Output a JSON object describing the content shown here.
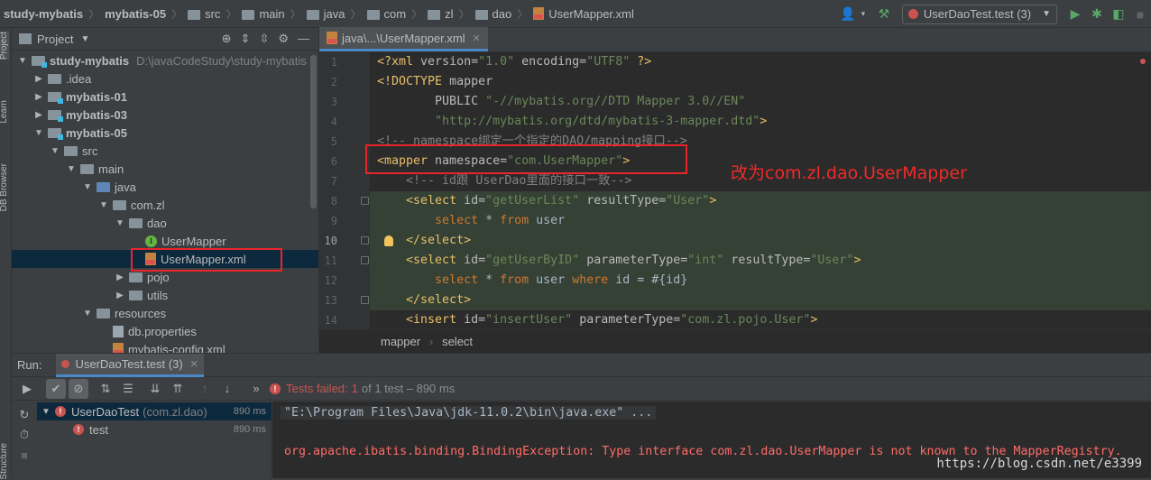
{
  "breadcrumbs": [
    "study-mybatis",
    "mybatis-05",
    "src",
    "main",
    "java",
    "com",
    "zl",
    "dao",
    "UserMapper.xml"
  ],
  "toolbar": {
    "run_config": "UserDaoTest.test (3)"
  },
  "left_strip": {
    "tabs": [
      "Project",
      "Learn",
      "DB Browser",
      "Structure"
    ]
  },
  "project": {
    "title": "Project",
    "tree": [
      {
        "label": "study-mybatis",
        "extra": "D:\\javaCodeStudy\\study-mybatis",
        "depth": 0,
        "arrow": "▼",
        "kind": "module",
        "bold": true
      },
      {
        "label": ".idea",
        "depth": 1,
        "arrow": "▶",
        "kind": "folder"
      },
      {
        "label": "mybatis-01",
        "depth": 1,
        "arrow": "▶",
        "kind": "module",
        "bold": true
      },
      {
        "label": "mybatis-03",
        "depth": 1,
        "arrow": "▶",
        "kind": "module",
        "bold": true
      },
      {
        "label": "mybatis-05",
        "depth": 1,
        "arrow": "▼",
        "kind": "module",
        "bold": true
      },
      {
        "label": "src",
        "depth": 2,
        "arrow": "▼",
        "kind": "folder"
      },
      {
        "label": "main",
        "depth": 3,
        "arrow": "▼",
        "kind": "folder"
      },
      {
        "label": "java",
        "depth": 4,
        "arrow": "▼",
        "kind": "folder-blue"
      },
      {
        "label": "com.zl",
        "depth": 5,
        "arrow": "▼",
        "kind": "folder"
      },
      {
        "label": "dao",
        "depth": 6,
        "arrow": "▼",
        "kind": "folder"
      },
      {
        "label": "UserMapper",
        "depth": 7,
        "arrow": "",
        "kind": "interface"
      },
      {
        "label": "UserMapper.xml",
        "depth": 7,
        "arrow": "",
        "kind": "xml",
        "selected": true
      },
      {
        "label": "pojo",
        "depth": 6,
        "arrow": "▶",
        "kind": "folder"
      },
      {
        "label": "utils",
        "depth": 6,
        "arrow": "▶",
        "kind": "folder"
      },
      {
        "label": "resources",
        "depth": 4,
        "arrow": "▼",
        "kind": "folder-res"
      },
      {
        "label": "db.properties",
        "depth": 5,
        "arrow": "",
        "kind": "props"
      },
      {
        "label": "mybatis-config.xml",
        "depth": 5,
        "arrow": "",
        "kind": "xml"
      }
    ]
  },
  "editor": {
    "tab_label": "java\\...\\UserMapper.xml",
    "line_numbers": [
      "1",
      "2",
      "3",
      "4",
      "5",
      "6",
      "7",
      "8",
      "9",
      "10",
      "11",
      "12",
      "13",
      "14"
    ],
    "lines": [
      [
        [
          "tag",
          "<?xml "
        ],
        [
          "attr",
          "version="
        ],
        [
          "str",
          "\"1.0\""
        ],
        [
          "attr",
          " encoding="
        ],
        [
          "str",
          "\"UTF8\""
        ],
        [
          "tag",
          " ?>"
        ]
      ],
      [
        [
          "tag",
          "<!DOCTYPE "
        ],
        [
          "attr",
          "mapper"
        ]
      ],
      [
        [
          "txt",
          "        "
        ],
        [
          "attr",
          "PUBLIC "
        ],
        [
          "str",
          "\"-//mybatis.org//DTD Mapper 3.0//EN\""
        ]
      ],
      [
        [
          "txt",
          "        "
        ],
        [
          "str",
          "\"http://mybatis.org/dtd/mybatis-3-mapper.dtd\""
        ],
        [
          "tag",
          ">"
        ]
      ],
      [
        [
          "cmt",
          "<!-- namespace绑定一个指定的DAO/mapping接口-->"
        ]
      ],
      [
        [
          "tag",
          "<mapper "
        ],
        [
          "attr",
          "namespace="
        ],
        [
          "str",
          "\"com.UserMapper\""
        ],
        [
          "tag",
          ">"
        ]
      ],
      [
        [
          "cmt",
          "    <!-- id跟 UserDao里面的接口一致-->"
        ]
      ],
      [
        [
          "txt",
          "    "
        ],
        [
          "tag",
          "<select "
        ],
        [
          "attr",
          "id="
        ],
        [
          "str",
          "\"getUserList\""
        ],
        [
          "attr",
          " resultType="
        ],
        [
          "str",
          "\"User\""
        ],
        [
          "tag",
          ">"
        ]
      ],
      [
        [
          "txt",
          "        "
        ],
        [
          "sqlkw",
          "select"
        ],
        [
          "sqlid",
          " * "
        ],
        [
          "sqlkw",
          "from"
        ],
        [
          "sqlid",
          " user"
        ]
      ],
      [
        [
          "txt",
          "    "
        ],
        [
          "tag",
          "</select>"
        ]
      ],
      [
        [
          "txt",
          "    "
        ],
        [
          "tag",
          "<select "
        ],
        [
          "attr",
          "id="
        ],
        [
          "str",
          "\"getUserByID\""
        ],
        [
          "attr",
          " parameterType="
        ],
        [
          "str",
          "\"int\""
        ],
        [
          "attr",
          " resultType="
        ],
        [
          "str",
          "\"User\""
        ],
        [
          "tag",
          ">"
        ]
      ],
      [
        [
          "txt",
          "        "
        ],
        [
          "sqlkw",
          "select"
        ],
        [
          "sqlid",
          " * "
        ],
        [
          "sqlkw",
          "from"
        ],
        [
          "sqlid",
          " user "
        ],
        [
          "sqlkw",
          "where"
        ],
        [
          "sqlid",
          " id = #{id}"
        ]
      ],
      [
        [
          "txt",
          "    "
        ],
        [
          "tag",
          "</select>"
        ]
      ],
      [
        [
          "txt",
          "    "
        ],
        [
          "tag",
          "<insert "
        ],
        [
          "attr",
          "id="
        ],
        [
          "str",
          "\"insertUser\""
        ],
        [
          "attr",
          " parameterType="
        ],
        [
          "str",
          "\"com.zl.pojo.User\""
        ],
        [
          "tag",
          ">"
        ]
      ]
    ],
    "current_line": "10",
    "breadcrumbs": [
      "mapper",
      "select"
    ],
    "annotation": "改为com.zl.dao.UserMapper"
  },
  "run": {
    "label": "Run:",
    "tab": "UserDaoTest.test (3)",
    "status_prefix": "Tests failed:",
    "status_count": "1",
    "status_suffix": "of 1 test – 890 ms",
    "tree": [
      {
        "label": "UserDaoTest",
        "extra": "(com.zl.dao)",
        "duration": "890 ms"
      },
      {
        "label": "test",
        "duration": "890 ms"
      }
    ],
    "console": [
      "\"E:\\Program Files\\Java\\jdk-11.0.2\\bin\\java.exe\" ...",
      "org.apache.ibatis.binding.BindingException: Type interface com.zl.dao.UserMapper is not known to the MapperRegistry."
    ],
    "watermark": "https://blog.csdn.net/e3399"
  },
  "colors": {
    "annotation_red": "#e8262a",
    "error_red": "#c75450",
    "accent_blue": "#4a88c7"
  }
}
